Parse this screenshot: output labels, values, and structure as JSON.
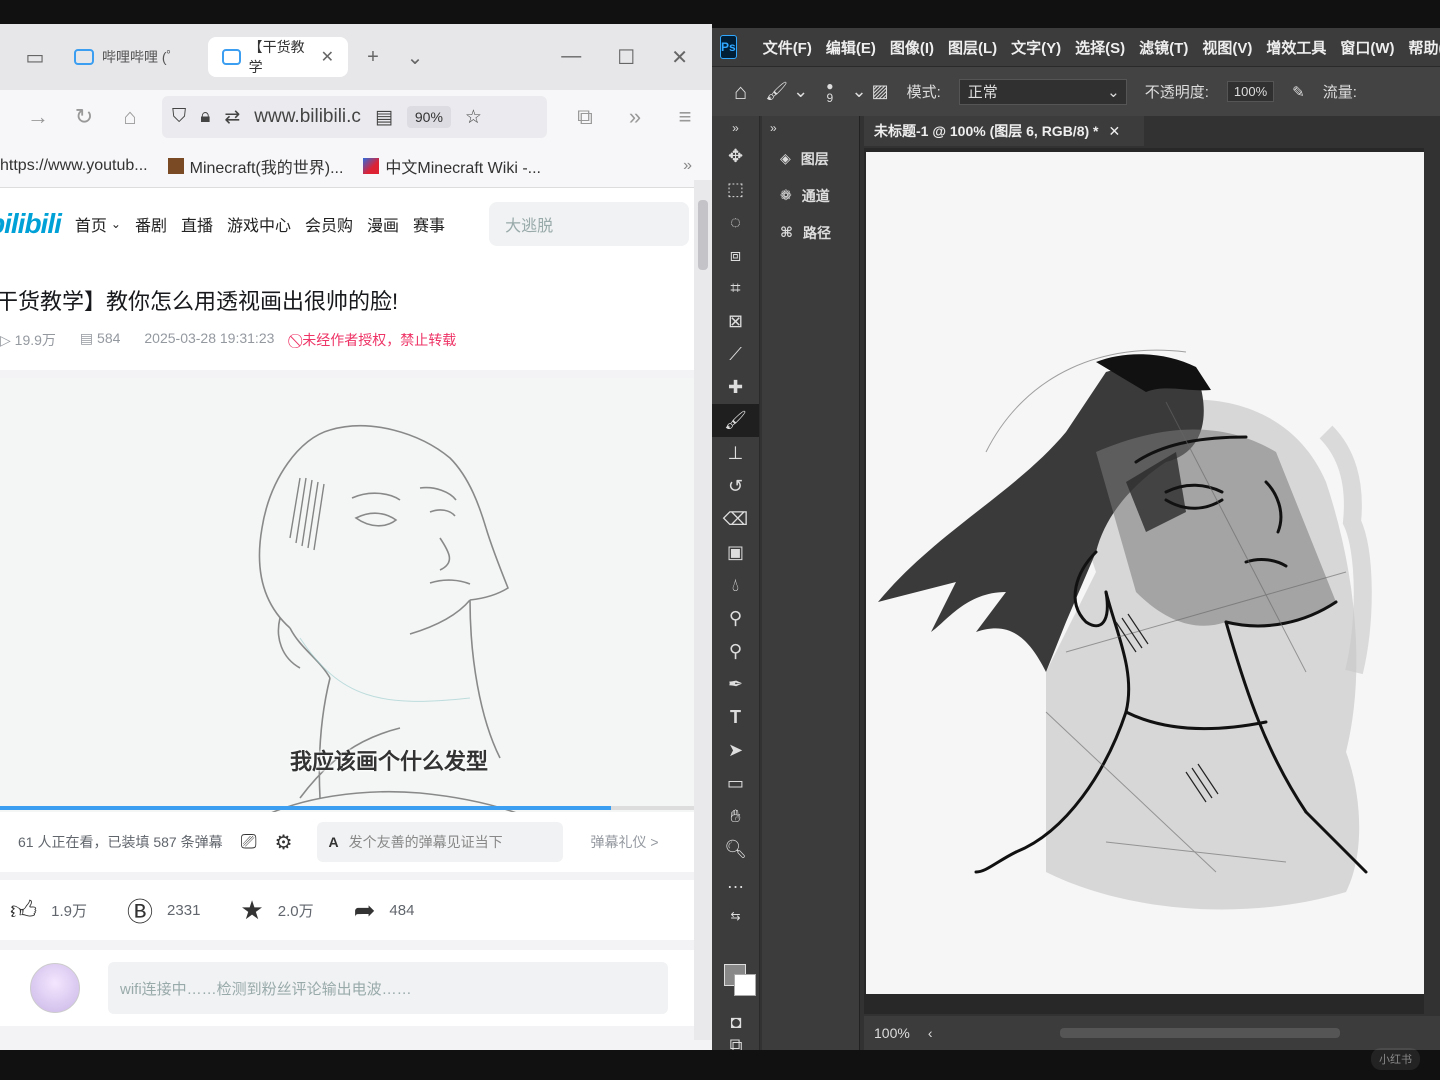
{
  "browser": {
    "tabs": [
      {
        "label": "哔哩哔哩 (゜"
      },
      {
        "label": "【干货教学"
      }
    ],
    "url": "www.bilibili.c",
    "zoom": "90%",
    "bookmarks": [
      "https://www.youtub...",
      "Minecraft(我的世界)...",
      "中文Minecraft Wiki -..."
    ],
    "site_nav": {
      "logo": "bilibili",
      "items": [
        "首页",
        "番剧",
        "直播",
        "游戏中心",
        "会员购",
        "漫画",
        "赛事"
      ],
      "search_placeholder": "大逃脱"
    },
    "video": {
      "title": "干货教学】教你怎么用透视画出很帅的脸!",
      "views": "19.9万",
      "danmaku_count": "584",
      "date": "2025-03-28 19:31:23",
      "copyright": "未经作者授权，禁止转载",
      "subtitle": "我应该画个什么发型",
      "progress": 0.88
    },
    "danmaku_bar": {
      "watching": "61 人正在看，已装填 587 条弹幕",
      "input_placeholder": "发个友善的弹幕见证当下",
      "etiquette": "弹幕礼仪 >"
    },
    "actions": {
      "likes": "1.9万",
      "coins": "2331",
      "favorites": "2.0万",
      "shares": "484"
    },
    "comment_placeholder": "wifi连接中……检测到粉丝评论输出电波……"
  },
  "photoshop": {
    "menu": [
      "文件(F)",
      "编辑(E)",
      "图像(I)",
      "图层(L)",
      "文字(Y)",
      "选择(S)",
      "滤镜(T)",
      "视图(V)",
      "增效工具",
      "窗口(W)",
      "帮助(H)"
    ],
    "options": {
      "brush_size": "9",
      "mode_label": "模式:",
      "mode_value": "正常",
      "opacity_label": "不透明度:",
      "opacity_value": "100%",
      "flow_label": "流量:"
    },
    "panels": [
      "图层",
      "通道",
      "路径"
    ],
    "document_tab": "未标题-1 @ 100% (图层 6, RGB/8) *",
    "zoom_status": "100%"
  },
  "watermark": "小红书"
}
